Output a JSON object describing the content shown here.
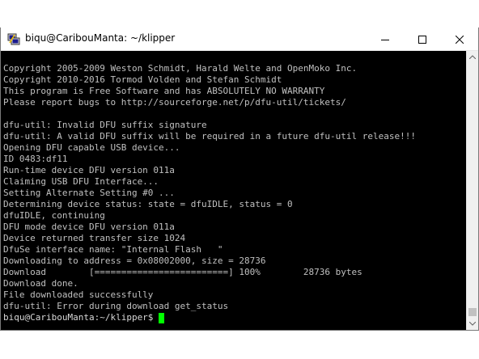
{
  "window": {
    "title": "biqu@CaribouManta: ~/klipper"
  },
  "titlebar_buttons": {
    "minimize_icon": "minimize-icon",
    "maximize_icon": "maximize-icon",
    "close_icon": "close-icon"
  },
  "terminal": {
    "lines": [
      "Copyright 2005-2009 Weston Schmidt, Harald Welte and OpenMoko Inc.",
      "Copyright 2010-2016 Tormod Volden and Stefan Schmidt",
      "This program is Free Software and has ABSOLUTELY NO WARRANTY",
      "Please report bugs to http://sourceforge.net/p/dfu-util/tickets/",
      "",
      "dfu-util: Invalid DFU suffix signature",
      "dfu-util: A valid DFU suffix will be required in a future dfu-util release!!!",
      "Opening DFU capable USB device...",
      "ID 0483:df11",
      "Run-time device DFU version 011a",
      "Claiming USB DFU Interface...",
      "Setting Alternate Setting #0 ...",
      "Determining device status: state = dfuIDLE, status = 0",
      "dfuIDLE, continuing",
      "DFU mode device DFU version 011a",
      "Device returned transfer size 1024",
      "DfuSe interface name: \"Internal Flash   \"",
      "Downloading to address = 0x08002000, size = 28736",
      "Download        [=========================] 100%        28736 bytes",
      "Download done.",
      "File downloaded successfully",
      "dfu-util: Error during download get_status"
    ],
    "prompt": "biqu@CaribouManta:~/klipper$ ",
    "cursor_color": "#00ff00",
    "text_color": "#c0c0c0",
    "background_color": "#000000"
  }
}
